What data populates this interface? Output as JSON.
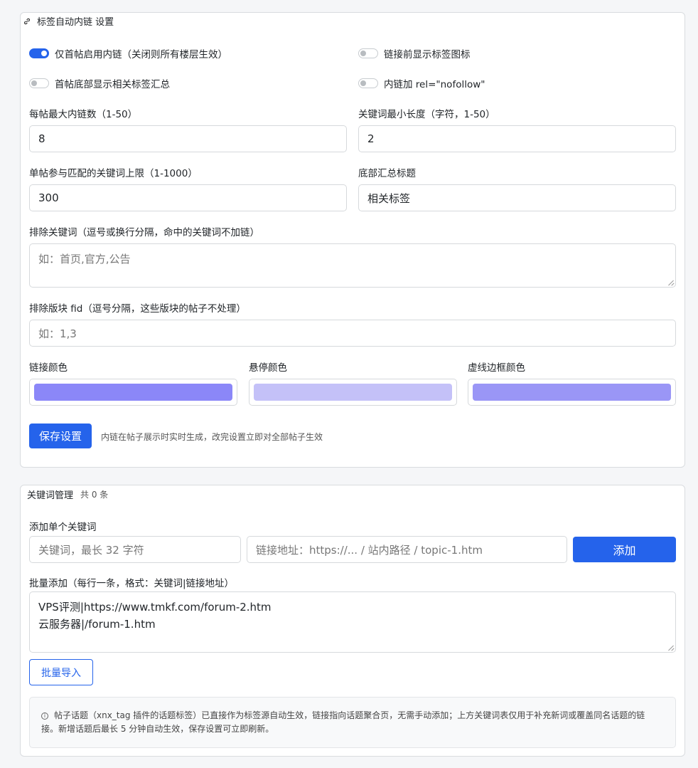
{
  "settings": {
    "title": "标签自动内链 设置",
    "toggles": {
      "first_post_only": {
        "label": "仅首帖启用内链（关闭则所有楼层生效）",
        "on": true
      },
      "show_tag_icon": {
        "label": "链接前显示标签图标",
        "on": false
      },
      "show_summary": {
        "label": "首帖底部显示相关标签汇总",
        "on": false
      },
      "nofollow": {
        "label": "内链加 rel=\"nofollow\"",
        "on": false
      }
    },
    "max_links": {
      "label": "每帖最大内链数（1-50）",
      "value": "8"
    },
    "min_length": {
      "label": "关键词最小长度（字符，1-50）",
      "value": "2"
    },
    "keyword_limit": {
      "label": "单帖参与匹配的关键词上限（1-1000）",
      "value": "300"
    },
    "summary_title": {
      "label": "底部汇总标题",
      "value": "相关标签"
    },
    "exclude_keywords": {
      "label": "排除关键词（逗号或换行分隔，命中的关键词不加链）",
      "placeholder": "如：首页,官方,公告"
    },
    "exclude_fids": {
      "label": "排除版块 fid（逗号分隔，这些版块的帖子不处理）",
      "placeholder": "如：1,3"
    },
    "colors": {
      "link": {
        "label": "链接颜色",
        "value": "#8b87f8"
      },
      "hover": {
        "label": "悬停颜色",
        "value": "#c4c1f8"
      },
      "border": {
        "label": "虚线边框颜色",
        "value": "#9a96f6"
      }
    },
    "save_label": "保存设置",
    "save_hint": "内链在帖子展示时实时生成，改完设置立即对全部帖子生效"
  },
  "keywords": {
    "title": "关键词管理",
    "count": "共 0 条",
    "add_single_label": "添加单个关键词",
    "keyword_placeholder": "关键词，最长 32 字符",
    "url_placeholder": "链接地址：https://... / 站内路径 / topic-1.htm",
    "add_label": "添加",
    "batch_label": "批量添加（每行一条，格式：关键词|链接地址）",
    "batch_lines": [
      "VPS评测|https://www.tmkf.com/forum-2.htm",
      "云服务器|/forum-1.htm"
    ],
    "import_label": "批量导入",
    "info_line1": "帖子话题（xnx_tag 插件的话题标签）已直接作为标签源自动生效，链接指向话题聚合页，无需手动添加；上方关键词表仅用于补充新词或覆盖同名话题的链",
    "info_line2": "接。新增话题后最长 5 分钟自动生效，保存设置可立即刷新。"
  },
  "theme": {
    "accent": "#2563eb",
    "border": "#d6d9dc"
  }
}
